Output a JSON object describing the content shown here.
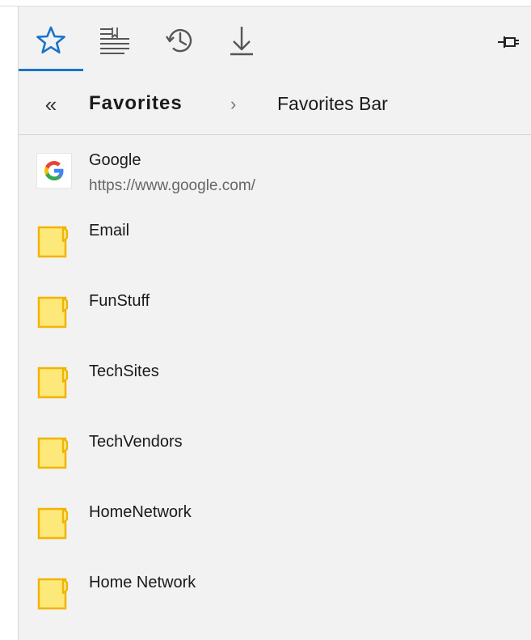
{
  "toolbar": {
    "tabs": [
      {
        "icon": "star-icon",
        "selected": true
      },
      {
        "icon": "reading-list-icon",
        "selected": false
      },
      {
        "icon": "history-icon",
        "selected": false
      },
      {
        "icon": "download-icon",
        "selected": false
      }
    ],
    "pin_icon": "pin-icon",
    "accent_color": "#1a73c9"
  },
  "breadcrumb": {
    "back_glyph": "«",
    "current": "Favorites",
    "separator": "›",
    "next": "Favorites Bar"
  },
  "items": [
    {
      "type": "site",
      "title": "Google",
      "url": "https://www.google.com/",
      "icon": "google-icon"
    },
    {
      "type": "folder",
      "title": "Email",
      "icon": "folder-icon"
    },
    {
      "type": "folder",
      "title": "FunStuff",
      "icon": "folder-icon"
    },
    {
      "type": "folder",
      "title": "TechSites",
      "icon": "folder-icon"
    },
    {
      "type": "folder",
      "title": "TechVendors",
      "icon": "folder-icon"
    },
    {
      "type": "folder",
      "title": "HomeNetwork",
      "icon": "folder-icon"
    },
    {
      "type": "folder",
      "title": "Home Network",
      "icon": "folder-icon"
    }
  ],
  "colors": {
    "panel_bg": "#f2f2f2",
    "folder_fill": "#fde87a",
    "folder_stroke": "#f2b300"
  }
}
